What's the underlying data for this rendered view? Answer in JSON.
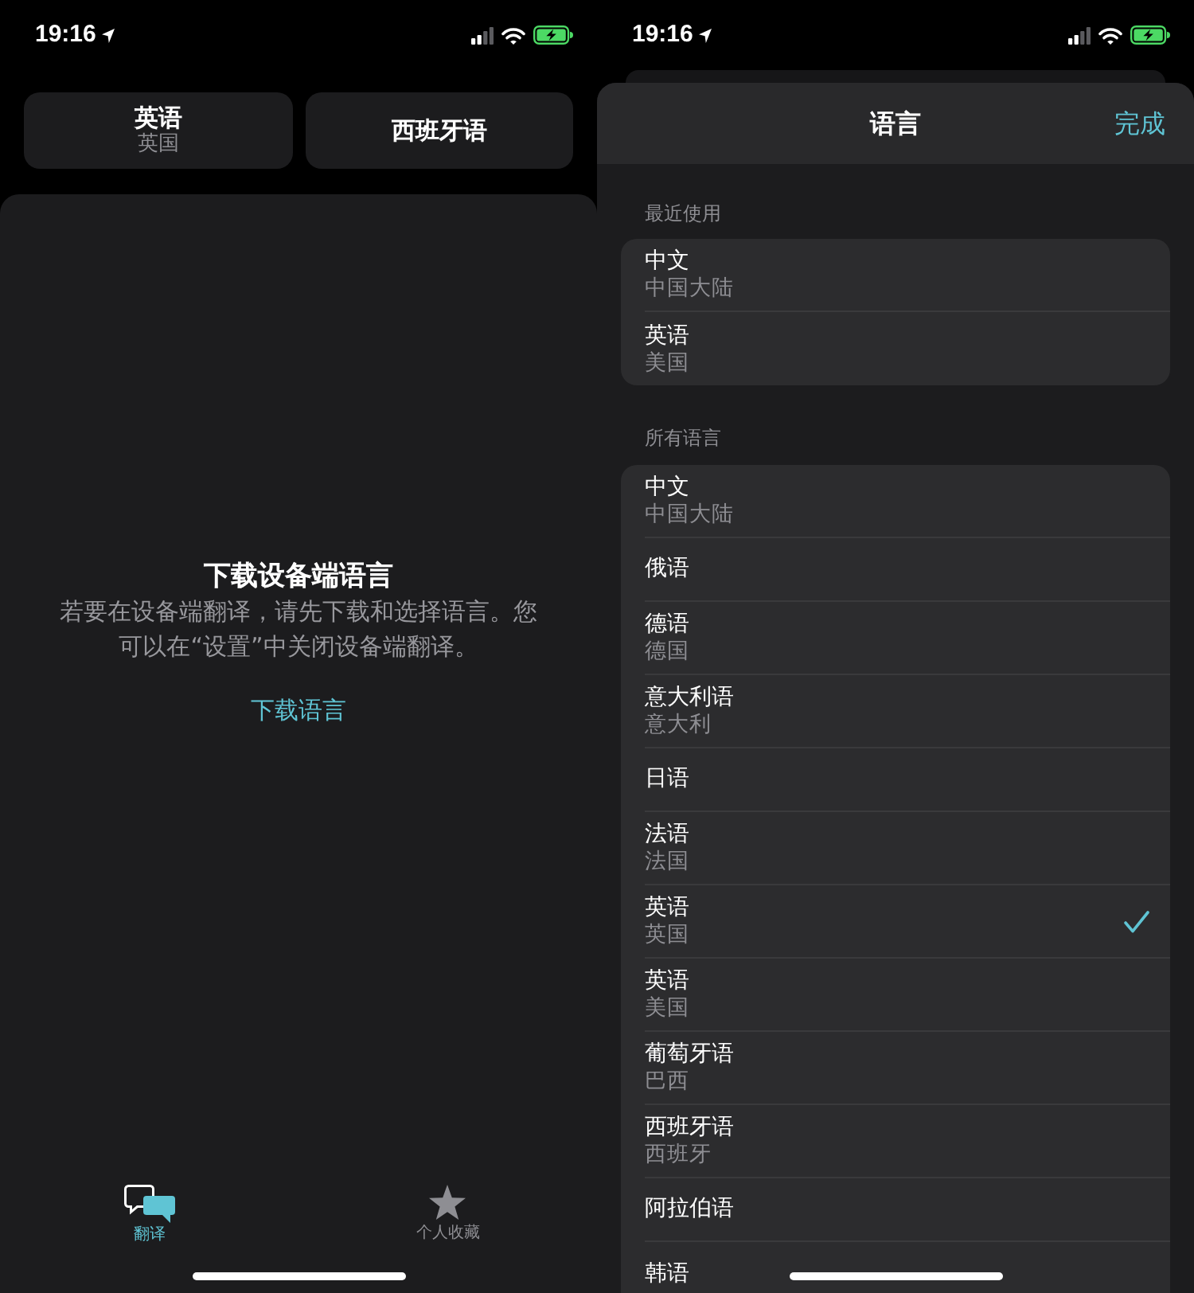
{
  "translate_screen": {
    "status_bar": {
      "time": "19:16"
    },
    "language_buttons": [
      {
        "language": "英语",
        "region": "英国"
      },
      {
        "language": "西班牙语"
      }
    ],
    "download_prompt": {
      "title": "下载设备端语言",
      "message": "若要在设备端翻译，请先下载和选择语言。您可以在“设置”中关闭设备端翻译。",
      "link": "下载语言"
    },
    "tab_bar": [
      {
        "label": "翻译",
        "selected": true
      },
      {
        "label": "个人收藏",
        "selected": false
      }
    ]
  },
  "language_picker": {
    "status_bar": {
      "time": "19:16"
    },
    "title": "语言",
    "done_button": "完成",
    "sections": [
      {
        "header": "最近使用",
        "items": [
          {
            "language": "中文",
            "region": "中国大陆"
          },
          {
            "language": "英语",
            "region": "美国"
          }
        ]
      },
      {
        "header": "所有语言",
        "items": [
          {
            "language": "中文",
            "region": "中国大陆",
            "selected": false
          },
          {
            "language": "俄语",
            "selected": false
          },
          {
            "language": "德语",
            "region": "德国",
            "selected": false
          },
          {
            "language": "意大利语",
            "region": "意大利",
            "selected": false
          },
          {
            "language": "日语",
            "selected": false
          },
          {
            "language": "法语",
            "region": "法国",
            "selected": false
          },
          {
            "language": "英语",
            "region": "英国",
            "selected": true
          },
          {
            "language": "英语",
            "region": "美国",
            "selected": false
          },
          {
            "language": "葡萄牙语",
            "region": "巴西",
            "selected": false
          },
          {
            "language": "西班牙语",
            "region": "西班牙",
            "selected": false
          },
          {
            "language": "阿拉伯语",
            "selected": false
          },
          {
            "language": "韩语",
            "selected": false
          }
        ]
      }
    ]
  }
}
